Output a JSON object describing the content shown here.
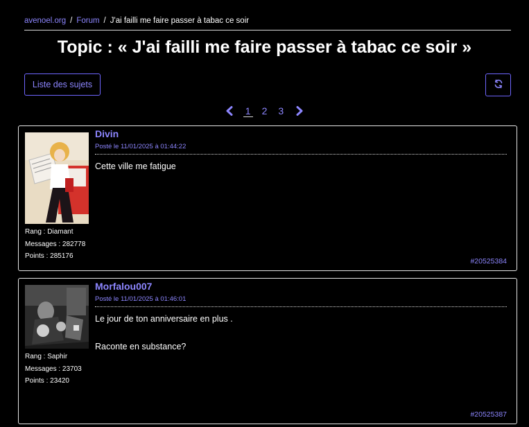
{
  "breadcrumb": {
    "site": "avenoel.org",
    "forum": "Forum",
    "current": "J'ai failli me faire passer à tabac ce soir",
    "separator": "/"
  },
  "page_title": "Topic : « J'ai failli me faire passer à tabac ce soir »",
  "toolbar": {
    "list_label": "Liste des sujets",
    "refresh_icon": "refresh-icon"
  },
  "pagination": {
    "prev_icon": "chevron-left-icon",
    "next_icon": "chevron-right-icon",
    "pages": [
      "1",
      "2",
      "3"
    ],
    "current": "1"
  },
  "colors": {
    "accent": "#8d86ff",
    "border": "#6f66ff",
    "background": "#000000",
    "text": "#ffffff"
  },
  "posts": [
    {
      "author": "Divin",
      "date": "Posté le 11/01/2025 à 01:44:22",
      "body": [
        "Cette ville me fatigue"
      ],
      "rank_label": "Rang",
      "rank": "Diamant",
      "messages_label": "Messages",
      "messages": "282778",
      "points_label": "Points",
      "points": "285176",
      "id": "#20525384"
    },
    {
      "author": "Morfalou007",
      "date": "Posté le 11/01/2025 à 01:46:01",
      "body": [
        "Le jour de ton anniversaire en plus .",
        "Raconte en substance?"
      ],
      "rank_label": "Rang",
      "rank": "Saphir",
      "messages_label": "Messages",
      "messages": "23703",
      "points_label": "Points",
      "points": "23420",
      "id": "#20525387"
    }
  ]
}
